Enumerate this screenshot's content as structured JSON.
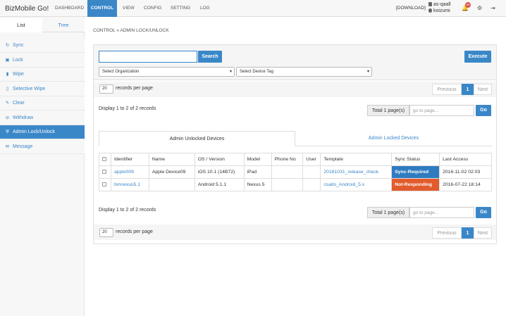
{
  "navbar": {
    "brand": "BizMobile Go!",
    "items": [
      "DASHBOARD",
      "CONTROL",
      "VIEW",
      "CONFIG",
      "SETTING",
      "LOG"
    ],
    "download": "[DOWNLOAD]",
    "user_org": "as-qaall",
    "user_name": "koizumi",
    "notification_count": "24",
    "icons": [
      "bell-icon",
      "gear-icon",
      "logout-icon"
    ],
    "accent": "#3a87c8"
  },
  "sidebar": {
    "tabs": [
      "List",
      "Tree"
    ],
    "items": [
      {
        "label": "Sync",
        "icon": "sync-icon"
      },
      {
        "label": "Lock",
        "icon": "lock-icon"
      },
      {
        "label": "Wipe",
        "icon": "trash-icon"
      },
      {
        "label": "Selective Wipe",
        "icon": "partial-trash-icon"
      },
      {
        "label": "Clear",
        "icon": "eraser-icon"
      },
      {
        "label": "Withdraw",
        "icon": "ban-icon"
      },
      {
        "label": "Admin Lock/Unlock",
        "icon": "shield-icon"
      },
      {
        "label": "Message",
        "icon": "envelope-icon"
      }
    ]
  },
  "breadcrumb": "CONTROL » ADMIN LOCK/UNLOCK",
  "filters": {
    "search_value": "",
    "search_button": "Search",
    "execute_button": "Execute",
    "organization_select": "Select Organization",
    "device_tag_select": "Select Device Tag"
  },
  "pager": {
    "per_page_value": "20",
    "per_page_label": "records per page",
    "previous": "Previous",
    "current_page": "1",
    "next": "Next",
    "display_info": "Display 1 to 2 of 2 records",
    "total_pages": "Total 1 page(s)",
    "goto_placeholder": "go to page...",
    "go_button": "Go"
  },
  "device_tabs": [
    "Admin Unlocked Devices",
    "Admin Locked Devices"
  ],
  "table": {
    "columns": [
      "Identifier",
      "Name",
      "OS / Version",
      "Model",
      "Phone No",
      "User",
      "Template",
      "Sync Status",
      "Last Access"
    ],
    "rows": [
      {
        "identifier": "apple009",
        "name": "Apple Device09",
        "os": "iOS 10.1 (14B72)",
        "model": "iPad",
        "phone": "",
        "user": "",
        "template": "20161031_release_check",
        "sync_status": "Sync-Required",
        "last_access": "2016-11-02 02:03"
      },
      {
        "identifier": "bmnexus5.1",
        "name": "",
        "os": "Android 5.1.1",
        "model": "Nexus 5",
        "phone": "",
        "user": "",
        "template": "csaito_Android_5.x",
        "sync_status": "Not-Responding",
        "last_access": "2016-07-22 18:14"
      }
    ],
    "status_colors": {
      "Sync-Required": "#2f7bc0",
      "Not-Responding": "#e25b2d"
    }
  }
}
